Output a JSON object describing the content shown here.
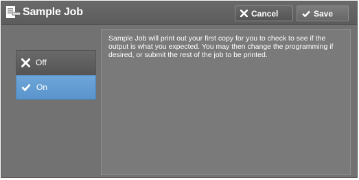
{
  "header": {
    "title": "Sample Job",
    "title_icon": "job-page-icon",
    "cancel_label": "Cancel",
    "cancel_icon": "close-icon",
    "save_label": "Save",
    "save_icon": "checkmark-icon"
  },
  "options": [
    {
      "label": "Off",
      "icon": "close-icon",
      "selected": false
    },
    {
      "label": "On",
      "icon": "checkmark-icon",
      "selected": true
    }
  ],
  "description": "Sample Job will print out your first copy for you to check to see if the output is what you expected.  You may then change the programming if desired, or submit the rest of the job to be printed.",
  "colors": {
    "panel_bg": "#727272",
    "selected_bg": "#5a94cc",
    "text": "#ffffff"
  }
}
